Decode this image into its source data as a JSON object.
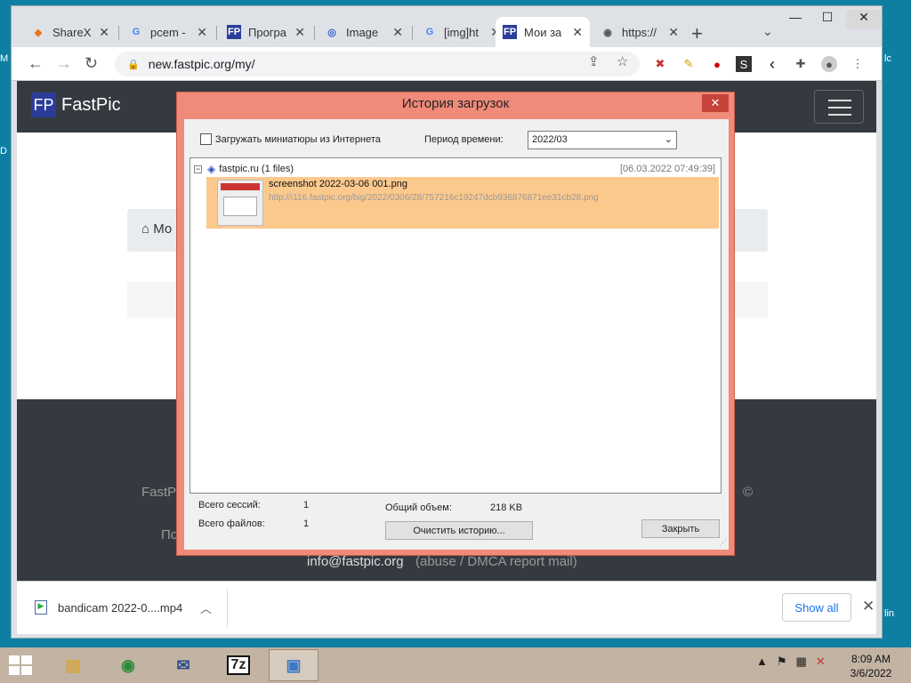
{
  "desktop": {
    "labels": [
      "M",
      "D",
      "lc",
      "lin"
    ]
  },
  "browser": {
    "tabs": [
      {
        "title": "ShareX",
        "icon": "sharex-icon",
        "active": false
      },
      {
        "title": "pcem -",
        "icon": "google-icon",
        "active": false
      },
      {
        "title": "Програ",
        "icon": "fastpic-icon",
        "active": false
      },
      {
        "title": "Image",
        "icon": "image-host-icon",
        "active": false
      },
      {
        "title": "[img]ht",
        "icon": "google-icon",
        "active": false
      },
      {
        "title": "Мои за",
        "icon": "fastpic-icon",
        "active": true
      },
      {
        "title": "https://",
        "icon": "globe-icon",
        "active": false
      }
    ],
    "new_tab": "+",
    "url": "new.fastpic.org/my/"
  },
  "site": {
    "logo_mark": "FP",
    "logo_text": "FastPic",
    "breadcrumb": "Мо",
    "footer_left": "FastPi",
    "footer_right": "©",
    "footer_left2": "По",
    "footer_email": "info@fastpic.org",
    "footer_abuse": "(abuse / DMCA report mail)"
  },
  "dialog": {
    "title": "История загрузок",
    "checkbox_label": "Загружать миниатюры из Интернета",
    "period_label": "Период времени:",
    "period_value": "2022/03",
    "group": {
      "label": "fastpic.ru (1 files)",
      "date": "[06.03.2022 07:49:39]"
    },
    "file": {
      "name": "screenshot 2022-03-06 001.png",
      "url": "http://i116.fastpic.org/big/2022/0306/28/757216c19247dcb936876871ee31cb28.png"
    },
    "stats": {
      "sessions_label": "Всего сессий:",
      "sessions_value": "1",
      "files_label": "Всего файлов:",
      "files_value": "1",
      "volume_label": "Общий объем:",
      "volume_value": "218 KB"
    },
    "clear_button": "Очистить историю...",
    "close_button": "Закрыть"
  },
  "downloads": {
    "file": "bandicam 2022-0....mp4",
    "show_all": "Show all"
  },
  "taskbar": {
    "apps": [
      "file-explorer",
      "chrome",
      "mail-app",
      "7zip",
      "sharex"
    ],
    "time": "8:09 AM",
    "date": "3/6/2022"
  }
}
